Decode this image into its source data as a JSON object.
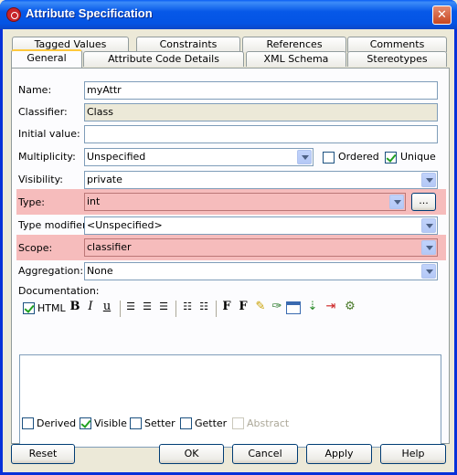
{
  "window": {
    "title": "Attribute Specification",
    "close": "✕"
  },
  "tabs_row1": [
    "Tagged Values",
    "Constraints",
    "References",
    "Comments"
  ],
  "tabs_row2": [
    "General",
    "Attribute Code Details",
    "XML Schema",
    "Stereotypes"
  ],
  "form": {
    "name_label": "Name:",
    "name_value": "myAttr",
    "classifier_label": "Classifier:",
    "classifier_value": "Class",
    "initial_label": "Initial value:",
    "initial_value": "",
    "multiplicity_label": "Multiplicity:",
    "multiplicity_value": "Unspecified",
    "ordered_label": "Ordered",
    "ordered_checked": false,
    "unique_label": "Unique",
    "unique_checked": true,
    "visibility_label": "Visibility:",
    "visibility_value": "private",
    "type_label": "Type:",
    "type_value": "int",
    "type_browse": "...",
    "type_modifier_label": "Type modifier:",
    "type_modifier_value": "<Unspecified>",
    "scope_label": "Scope:",
    "scope_value": "classifier",
    "aggregation_label": "Aggregation:",
    "aggregation_value": "None",
    "documentation_label": "Documentation:"
  },
  "doc_toolbar": {
    "html_label": "HTML",
    "html_checked": true,
    "bold": "B",
    "italic": "I",
    "underline": "u",
    "font": "F",
    "font_size": "F"
  },
  "flags": [
    {
      "label": "Derived",
      "checked": false,
      "enabled": true
    },
    {
      "label": "Visible",
      "checked": true,
      "enabled": true
    },
    {
      "label": "Setter",
      "checked": false,
      "enabled": true
    },
    {
      "label": "Getter",
      "checked": false,
      "enabled": true
    },
    {
      "label": "Abstract",
      "checked": false,
      "enabled": false
    }
  ],
  "buttons": {
    "reset": "Reset",
    "ok": "OK",
    "cancel": "Cancel",
    "apply": "Apply",
    "help": "Help"
  },
  "colors": {
    "highlight": "#f6bcbc",
    "titlebar": "#0658e8"
  }
}
